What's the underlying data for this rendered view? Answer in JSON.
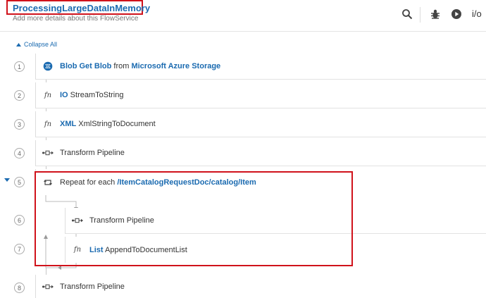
{
  "header": {
    "title": "ProcessingLargeDataInMemory",
    "subtitle": "Add more details about this FlowService",
    "io_label": "i/o",
    "toolbar_icons": [
      "search-icon",
      "debug-bug-icon",
      "run-play-icon"
    ]
  },
  "collapse_label": "Collapse All",
  "colors": {
    "accent": "#1a6ab0",
    "highlight": "#d0121b"
  },
  "steps": [
    {
      "num": "1",
      "icon": "azure-blob-icon",
      "parts": [
        "Blob Get Blob",
        " from ",
        "Microsoft Azure Storage"
      ]
    },
    {
      "num": "2",
      "icon": "function-icon",
      "parts": [
        "IO",
        " StreamToString"
      ]
    },
    {
      "num": "3",
      "icon": "function-icon",
      "parts": [
        "XML",
        " XmlStringToDocument"
      ]
    },
    {
      "num": "4",
      "icon": "transform-pipeline-icon",
      "parts": [
        "Transform Pipeline"
      ]
    },
    {
      "num": "5",
      "icon": "repeat-loop-icon",
      "parts": [
        "Repeat for each ",
        " /ItemCatalogRequestDoc/catalog/Item"
      ]
    },
    {
      "num": "6",
      "icon": "transform-pipeline-icon",
      "parts": [
        "Transform Pipeline"
      ]
    },
    {
      "num": "7",
      "icon": "function-icon",
      "parts": [
        "List",
        " AppendToDocumentList"
      ]
    },
    {
      "num": "8",
      "icon": "transform-pipeline-icon",
      "parts": [
        "Transform Pipeline"
      ]
    }
  ]
}
